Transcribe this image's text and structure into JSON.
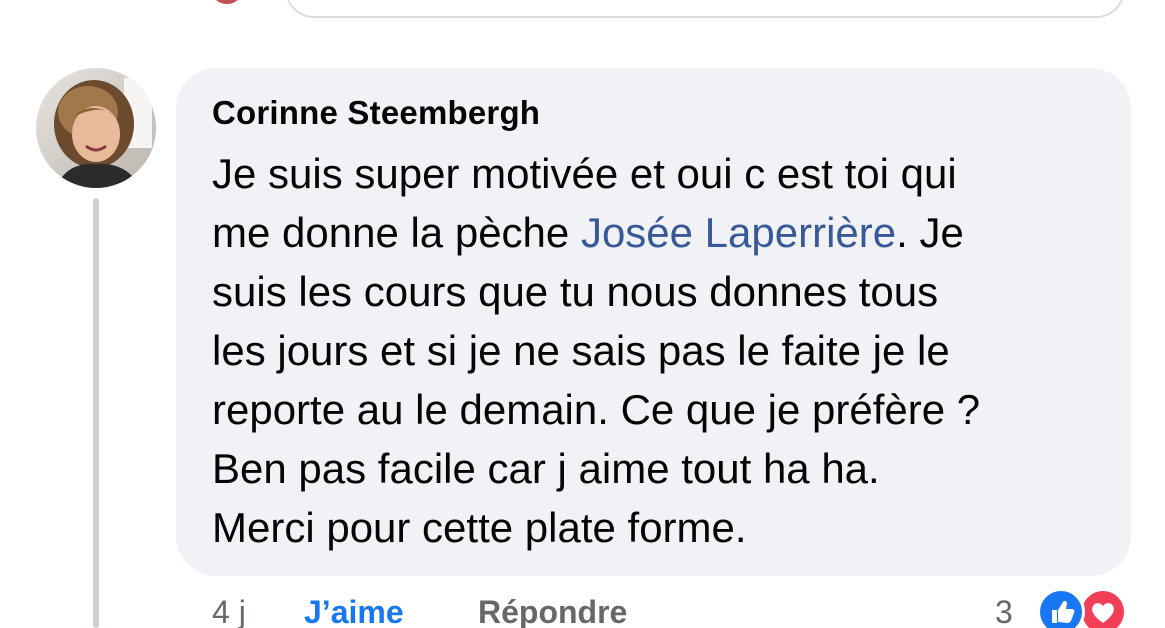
{
  "comment": {
    "author": "Corinne Steembergh",
    "text_lines": [
      {
        "before": "Je suis super motivée et oui c est toi qui",
        "mention": "",
        "after": ""
      },
      {
        "before": "me donne la pèche ",
        "mention": "Josée Laperrière",
        "after": ". Je"
      },
      {
        "before": "suis les cours que tu nous donnes tous",
        "mention": "",
        "after": ""
      },
      {
        "before": "les jours et si je ne sais pas le faite je le",
        "mention": "",
        "after": ""
      },
      {
        "before": "reporte au le demain. Ce que je préfère ?",
        "mention": "",
        "after": ""
      },
      {
        "before": "Ben pas facile car j aime tout ha ha.",
        "mention": "",
        "after": ""
      },
      {
        "before": "Merci pour cette plate forme.",
        "mention": "",
        "after": ""
      }
    ]
  },
  "actions": {
    "time": "4 j",
    "like_label": "J’aime",
    "reply_label": "Répondre"
  },
  "reactions": {
    "count": "3",
    "icons": [
      "thumbs-up-icon",
      "heart-icon"
    ]
  },
  "colors": {
    "bubble": "#f0f2f5",
    "mention": "#385898",
    "like_active": "#1877f2",
    "love": "#f33e58",
    "secondary_text": "#65676b"
  }
}
